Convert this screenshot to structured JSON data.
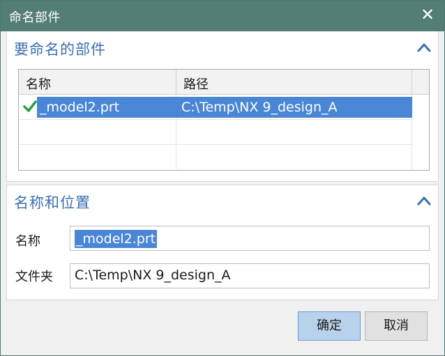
{
  "window": {
    "title": "命名部件",
    "close_glyph": "✕"
  },
  "section_parts": {
    "title": "要命名的部件",
    "collapse_icon": "chevron-up-icon",
    "table": {
      "columns": [
        "名称",
        "路径"
      ],
      "rows": [
        {
          "status_icon": "checkmark-icon",
          "name": "_model2.prt",
          "path": "C:\\Temp\\NX 9_design_A",
          "selected": true
        }
      ]
    }
  },
  "section_name_location": {
    "title": "名称和位置",
    "collapse_icon": "chevron-up-icon",
    "name_label": "名称",
    "name_value": "_model2.prt",
    "folder_label": "文件夹",
    "folder_value": "C:\\Temp\\NX 9_design_A"
  },
  "buttons": {
    "ok": "确定",
    "cancel": "取消"
  },
  "colors": {
    "titlebar": "#537e76",
    "section_title": "#3b6fb2",
    "selection": "#4a86d6",
    "check": "#2e9e3e",
    "ok_button": "#b9d2ec"
  }
}
